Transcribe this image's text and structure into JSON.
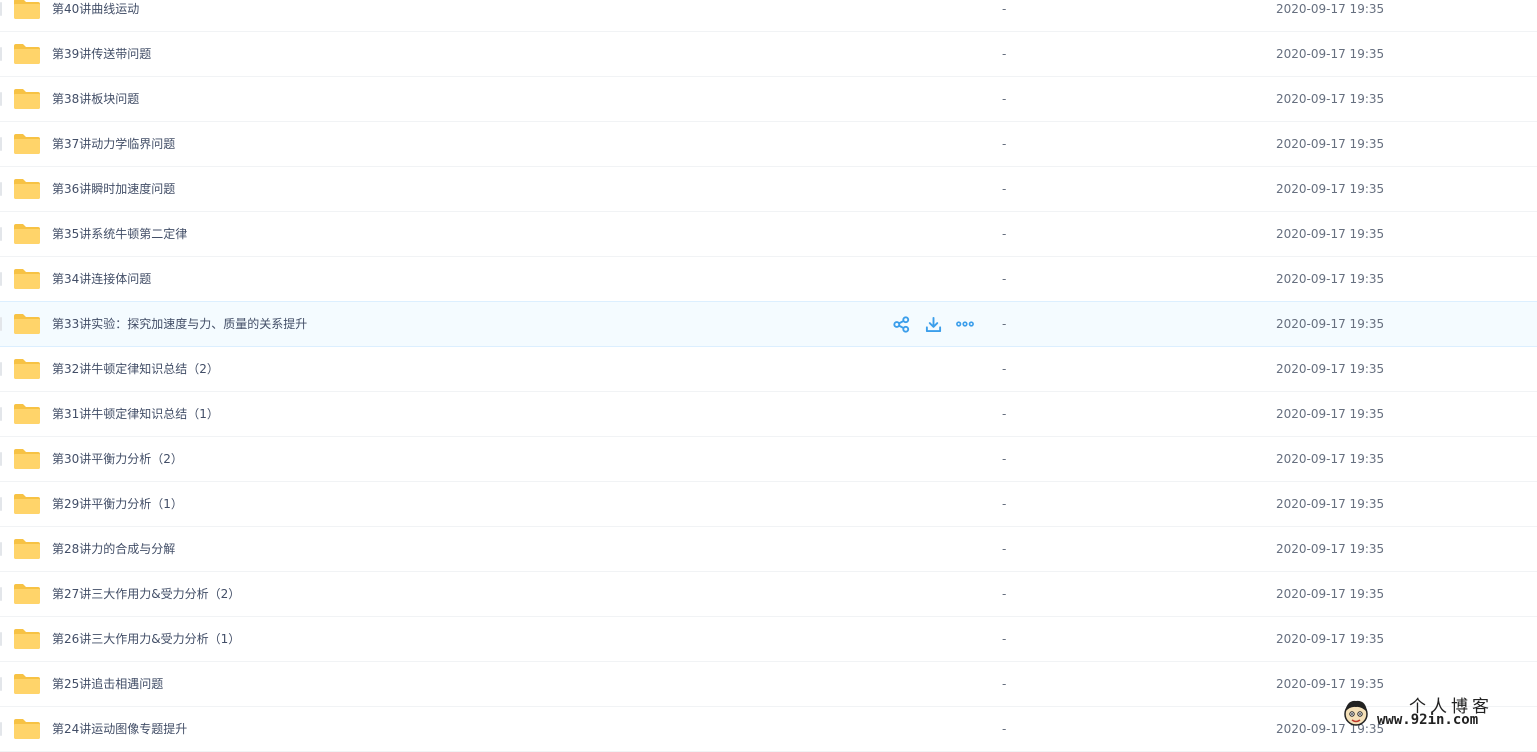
{
  "colors": {
    "folder": "#ffd46a",
    "folder_tab": "#f7c244",
    "action_icon": "#3b9eeb",
    "hover_row": "#f4fbff"
  },
  "rows": [
    {
      "name": "第40讲曲线运动",
      "size": "-",
      "date": "2020-09-17 19:35"
    },
    {
      "name": "第39讲传送带问题",
      "size": "-",
      "date": "2020-09-17 19:35"
    },
    {
      "name": "第38讲板块问题",
      "size": "-",
      "date": "2020-09-17 19:35"
    },
    {
      "name": "第37讲动力学临界问题",
      "size": "-",
      "date": "2020-09-17 19:35"
    },
    {
      "name": "第36讲瞬时加速度问题",
      "size": "-",
      "date": "2020-09-17 19:35"
    },
    {
      "name": "第35讲系统牛顿第二定律",
      "size": "-",
      "date": "2020-09-17 19:35"
    },
    {
      "name": "第34讲连接体问题",
      "size": "-",
      "date": "2020-09-17 19:35"
    },
    {
      "name": "第33讲实验：探究加速度与力、质量的关系提升",
      "size": "-",
      "date": "2020-09-17 19:35",
      "hovered": true
    },
    {
      "name": "第32讲牛顿定律知识总结（2）",
      "size": "-",
      "date": "2020-09-17 19:35"
    },
    {
      "name": "第31讲牛顿定律知识总结（1）",
      "size": "-",
      "date": "2020-09-17 19:35"
    },
    {
      "name": "第30讲平衡力分析（2）",
      "size": "-",
      "date": "2020-09-17 19:35"
    },
    {
      "name": "第29讲平衡力分析（1）",
      "size": "-",
      "date": "2020-09-17 19:35"
    },
    {
      "name": "第28讲力的合成与分解",
      "size": "-",
      "date": "2020-09-17 19:35"
    },
    {
      "name": "第27讲三大作用力&受力分析（2）",
      "size": "-",
      "date": "2020-09-17 19:35"
    },
    {
      "name": "第26讲三大作用力&受力分析（1）",
      "size": "-",
      "date": "2020-09-17 19:35"
    },
    {
      "name": "第25讲追击相遇问题",
      "size": "-",
      "date": "2020-09-17 19:35"
    },
    {
      "name": "第24讲运动图像专题提升",
      "size": "-",
      "date": "2020-09-17 19:35"
    }
  ],
  "row_actions": {
    "share_icon": "share-icon",
    "download_icon": "download-icon",
    "more_icon": "more-icon"
  },
  "watermark": {
    "title": "个人博客",
    "url": "www.92in.com"
  }
}
